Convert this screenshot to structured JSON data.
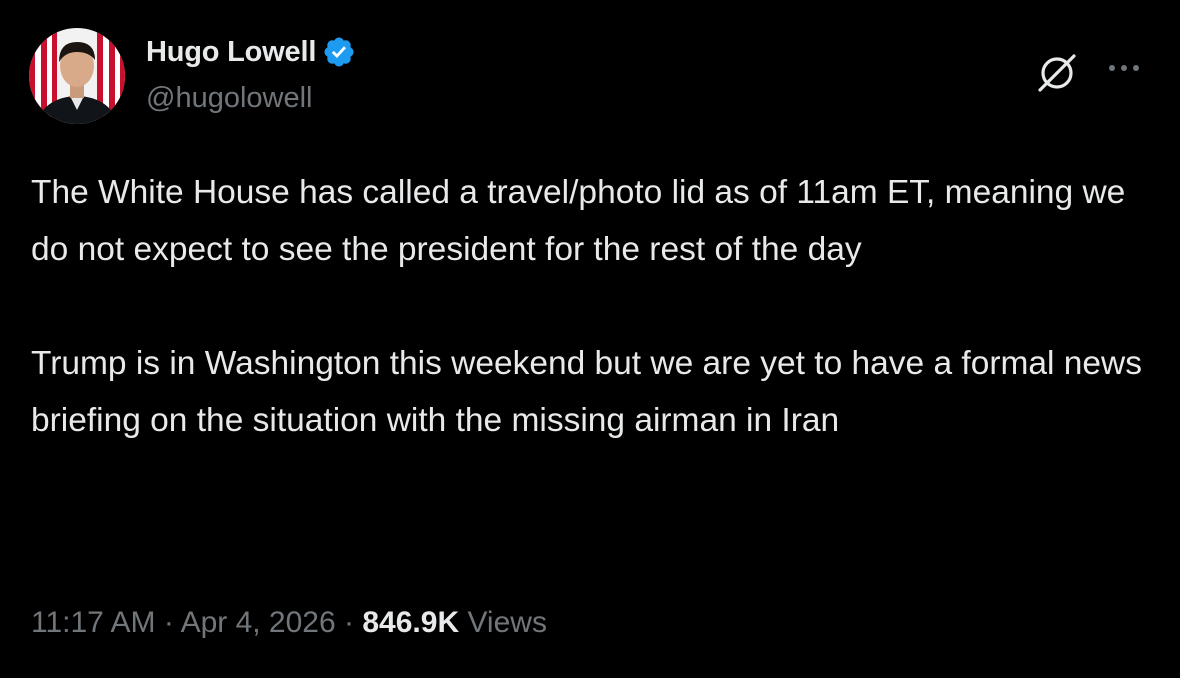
{
  "author": {
    "display_name": "Hugo Lowell",
    "handle": "@hugolowell",
    "verified": true
  },
  "icons": {
    "verified": "verified-badge-icon",
    "grok": "grok-icon",
    "more": "more-options-icon"
  },
  "colors": {
    "background": "#000000",
    "primary_text": "#e7e9ea",
    "secondary_text": "#71767b",
    "verified_blue": "#1d9bf0"
  },
  "tweet": {
    "paragraphs": [
      "The White House has called a travel/photo lid as of 11am ET, meaning we do not expect to see the president for the rest of the day",
      "Trump is in Washington this weekend but we are yet to have a formal news briefing on the situation with the missing airman in Iran"
    ],
    "time": "11:17 AM",
    "separator": "·",
    "date": "Apr 4, 2026",
    "views_count": "846.9K",
    "views_label": "Views"
  }
}
